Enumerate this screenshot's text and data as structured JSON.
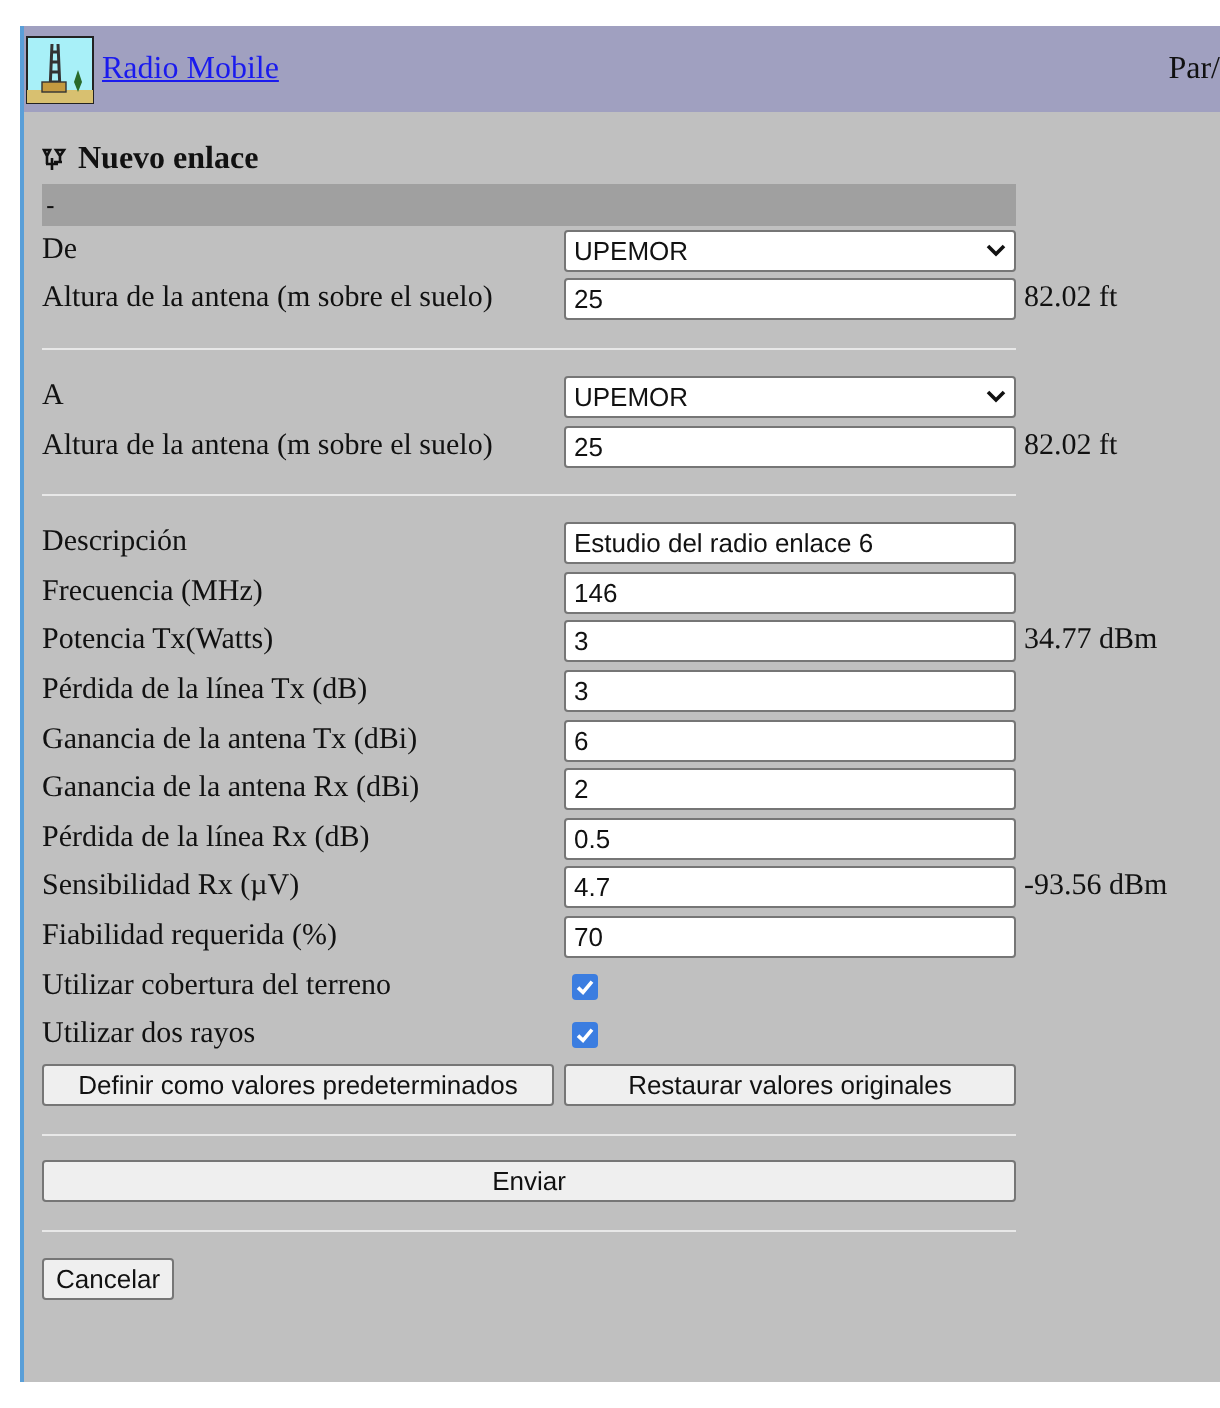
{
  "header": {
    "title": "Radio Mobile",
    "right_text": "Par/"
  },
  "form": {
    "title": "Nuevo enlace",
    "banner": "-",
    "sections": [
      {
        "rows": [
          {
            "kind": "select",
            "label": "De",
            "value": "UPEMOR"
          },
          {
            "kind": "input",
            "label": "Altura de la antena (m sobre el suelo)",
            "value": "25",
            "unit": "82.02 ft"
          }
        ]
      },
      {
        "rows": [
          {
            "kind": "select",
            "label": "A",
            "value": "UPEMOR"
          },
          {
            "kind": "input",
            "label": "Altura de la antena (m sobre el suelo)",
            "value": "25",
            "unit": "82.02 ft"
          }
        ]
      },
      {
        "rows": [
          {
            "kind": "input",
            "label": "Descripción",
            "value": "Estudio del radio enlace 6"
          },
          {
            "kind": "input",
            "label": "Frecuencia (MHz)",
            "value": "146"
          },
          {
            "kind": "input",
            "label": "Potencia Tx(Watts)",
            "value": "3",
            "unit": "34.77 dBm"
          },
          {
            "kind": "input",
            "label": "Pérdida de la línea Tx (dB)",
            "value": "3"
          },
          {
            "kind": "input",
            "label": "Ganancia de la antena Tx (dBi)",
            "value": "6"
          },
          {
            "kind": "input",
            "label": "Ganancia de la antena Rx (dBi)",
            "value": "2"
          },
          {
            "kind": "input",
            "label": "Pérdida de la línea Rx (dB)",
            "value": "0.5"
          },
          {
            "kind": "input",
            "label": "Sensibilidad Rx (µV)",
            "value": "4.7",
            "unit": "-93.56 dBm"
          },
          {
            "kind": "input",
            "label": "Fiabilidad requerida (%)",
            "value": "70"
          },
          {
            "kind": "checkbox",
            "label": "Utilizar cobertura del terreno",
            "checked": true
          },
          {
            "kind": "checkbox",
            "label": "Utilizar dos rayos",
            "checked": true
          },
          {
            "kind": "buttons",
            "buttons": [
              "Definir como valores predeterminados",
              "Restaurar valores originales"
            ]
          }
        ]
      },
      {
        "rows": [
          {
            "kind": "wide_button",
            "text": "Enviar"
          }
        ]
      },
      {
        "rows": [
          {
            "kind": "small_button",
            "text": "Cancelar"
          }
        ]
      }
    ]
  }
}
